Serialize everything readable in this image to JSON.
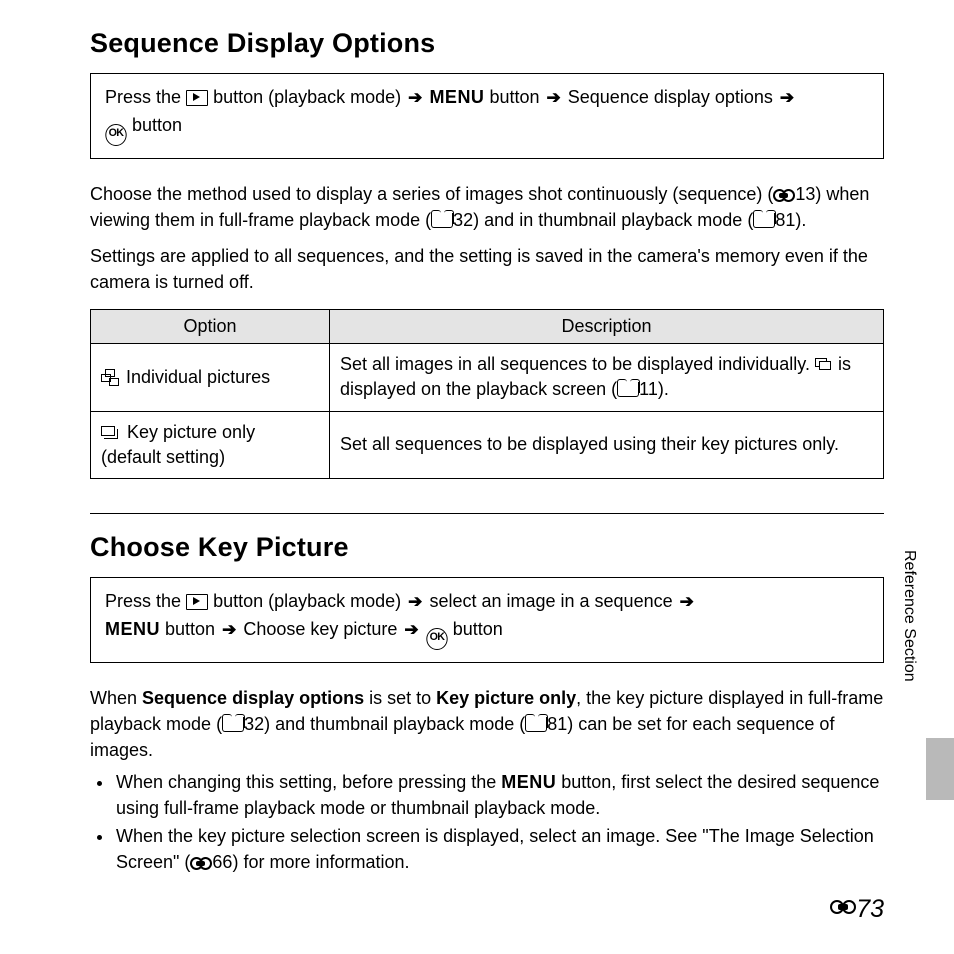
{
  "section1": {
    "title": "Sequence Display Options",
    "path_parts": {
      "press": "Press the ",
      "playback": " button (playback mode) ",
      "menu": "MENU",
      "btn_word": " button ",
      "option": " Sequence display options ",
      "ok_end": " button"
    },
    "para1_a": "Choose the method used to display a series of images shot continuously (sequence) (",
    "para1_b": "13) when viewing them in full-frame playback mode (",
    "para1_c": "32) and in thumbnail playback mode (",
    "para1_d": "81).",
    "para2": "Settings are applied to all sequences, and the setting is saved in the camera's memory even if the camera is turned off.",
    "table": {
      "head_option": "Option",
      "head_desc": "Description",
      "row1_opt": " Individual pictures",
      "row1_desc_a": "Set all images in all sequences to be displayed individually. ",
      "row1_desc_b": " is displayed on the playback screen (",
      "row1_desc_c": "11).",
      "row2_opt_a": " Key picture only",
      "row2_opt_b": "(default setting)",
      "row2_desc": "Set all sequences to be displayed using their key pictures only."
    }
  },
  "section2": {
    "title": "Choose Key Picture",
    "path_parts": {
      "press": "Press the ",
      "playback": " button (playback mode) ",
      "select": " select an image in a sequence ",
      "menu": "MENU",
      "btn_word": " button ",
      "option": " Choose key picture ",
      "ok_end": " button"
    },
    "para1_a": "When ",
    "para1_bold1": "Sequence display options",
    "para1_b": " is set to ",
    "para1_bold2": "Key picture only",
    "para1_c": ", the key picture displayed in full-frame playback mode (",
    "para1_d": "32) and thumbnail playback mode (",
    "para1_e": "81) can be set for each sequence of images.",
    "bullet1_a": "When changing this setting, before pressing the ",
    "bullet1_menu": "MENU",
    "bullet1_b": " button, first select the desired sequence using full-frame playback mode or thumbnail playback mode.",
    "bullet2_a": "When the key picture selection screen is displayed, select an image. See \"The Image Selection Screen\" (",
    "bullet2_b": "66) for more information."
  },
  "side_label": "Reference Section",
  "page_number": "73",
  "ok_text": "OK"
}
